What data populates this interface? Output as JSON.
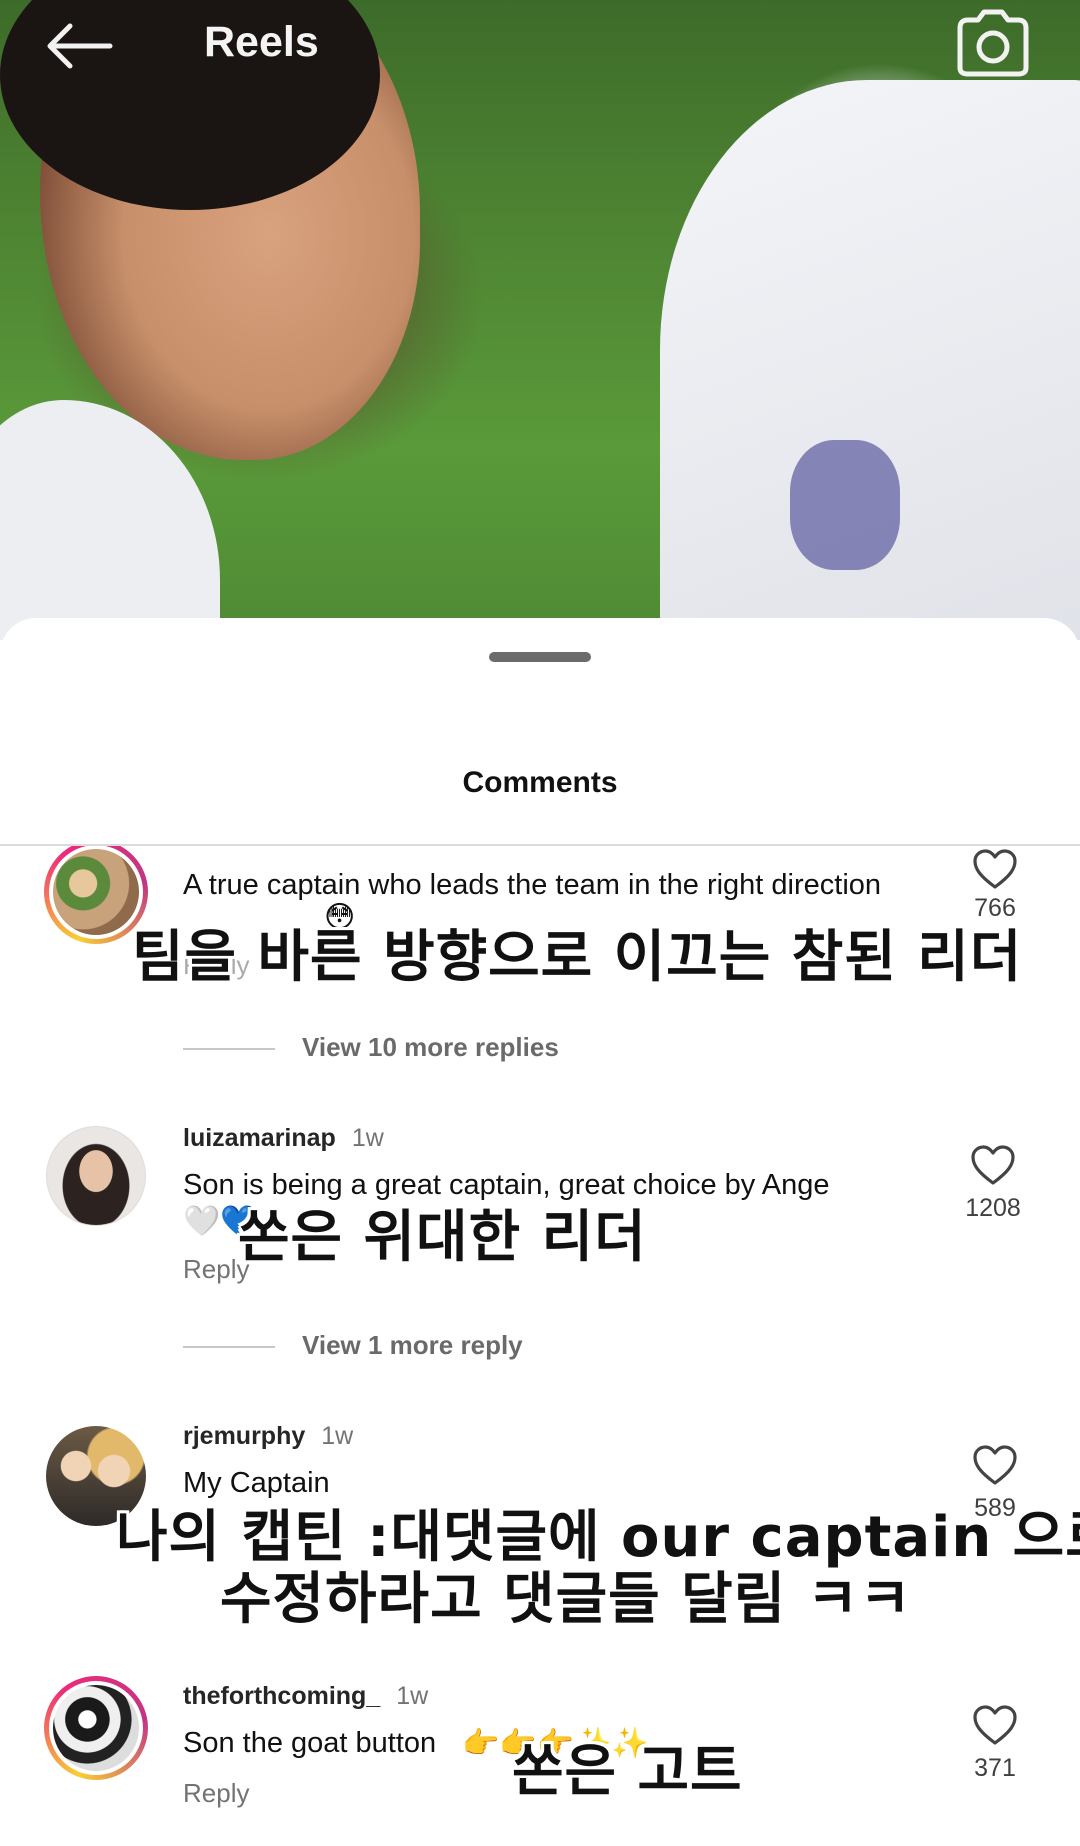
{
  "header": {
    "title": "Reels"
  },
  "sheet": {
    "title": "Comments"
  },
  "comments": [
    {
      "username": "",
      "time": "",
      "text": "A true captain who leads the team in the right direction",
      "reply_label": "Reply",
      "likes": "766",
      "view_more": "View 10 more replies",
      "overlay_ko": "팀을 바른 방향으로 이끄는 참된 리더"
    },
    {
      "username": "luizamarinap",
      "time": "1w",
      "text": "Son is being a great captain, great choice by Ange",
      "emoji": "🤍💙",
      "reply_label": "Reply",
      "likes": "1208",
      "view_more": "View 1 more reply",
      "overlay_ko": "쏜은 위대한 리더"
    },
    {
      "username": "rjemurphy",
      "time": "1w",
      "text": "My Captain",
      "likes": "589",
      "overlay_ko_line1": "나의 캡틴 :대댓글에 our captain 으로",
      "overlay_ko_line2": "수정하라고 댓글들 달림 ㅋㅋ"
    },
    {
      "username": "theforthcoming_",
      "time": "1w",
      "text": "Son the goat button",
      "emoji": "👉👉👉✨✨",
      "reply_label": "Reply",
      "likes": "371",
      "overlay_ko": "쏜은 고트"
    }
  ]
}
